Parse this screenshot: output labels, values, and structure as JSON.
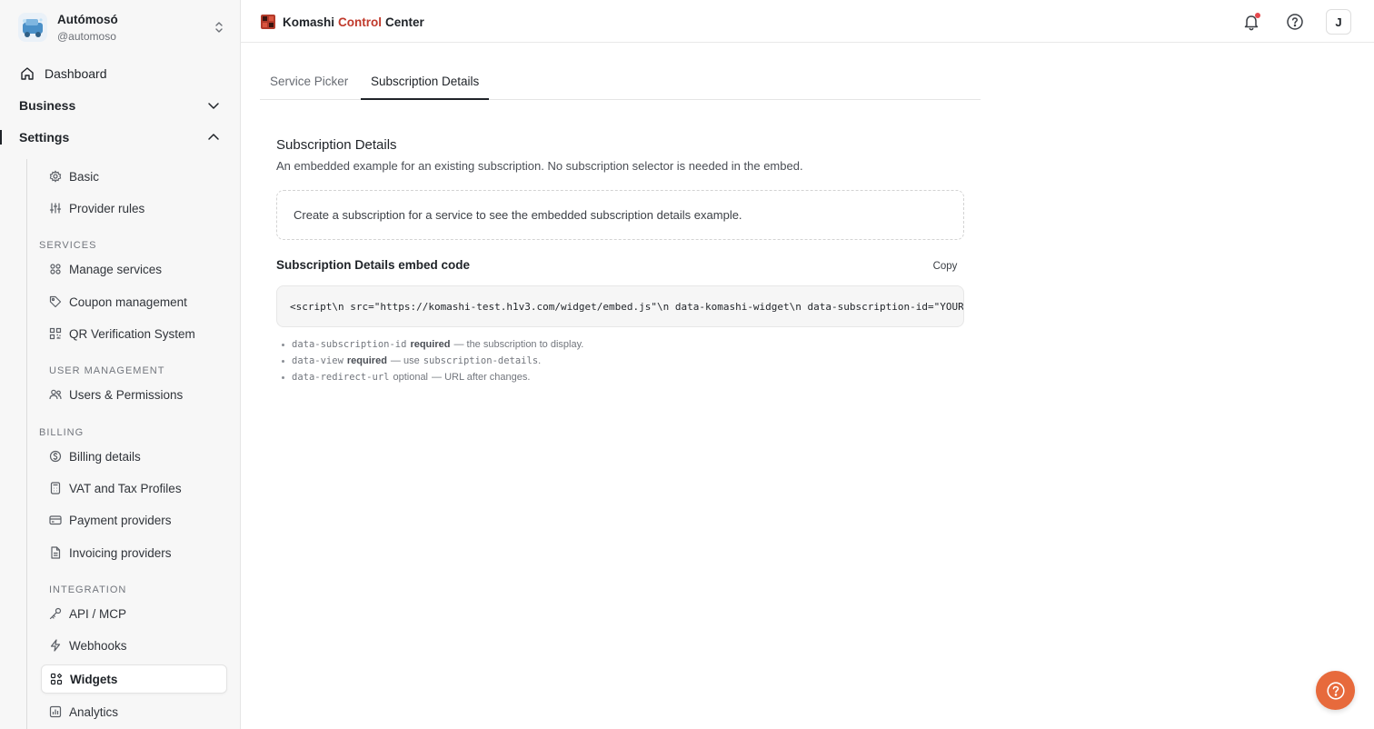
{
  "account": {
    "name": "Autómosó",
    "handle": "@automoso"
  },
  "nav": {
    "dashboard": "Dashboard",
    "business": "Business",
    "settings": "Settings",
    "basic": "Basic",
    "provider_rules": "Provider rules",
    "services_section": "SERVICES",
    "manage_services": "Manage services",
    "coupon_management": "Coupon management",
    "qr_verification": "QR Verification System",
    "user_mgmt_section": "USER MANAGEMENT",
    "users_permissions": "Users & Permissions",
    "billing_section": "BILLING",
    "billing_details": "Billing details",
    "vat_tax": "VAT and Tax Profiles",
    "payment_providers": "Payment providers",
    "invoicing_providers": "Invoicing providers",
    "integration_section": "INTEGRATION",
    "api_mcp": "API / MCP",
    "webhooks": "Webhooks",
    "widgets": "Widgets",
    "analytics": "Analytics"
  },
  "header": {
    "brand_part1": "Komashi",
    "brand_part2": "Control",
    "brand_part3": "Center",
    "user_initial": "J",
    "brand_accent_color": "#c0392b"
  },
  "tabs": {
    "service_picker": "Service Picker",
    "subscription_details": "Subscription Details"
  },
  "content": {
    "title": "Subscription Details",
    "description": "An embedded example for an existing subscription. No subscription selector is needed in the embed.",
    "empty_message": "Create a subscription for a service to see the embedded subscription details example.",
    "embed_title": "Subscription Details embed code",
    "copy_label": "Copy",
    "code": "<script\\n  src=\"https://komashi-test.h1v3.com/widget/embed.js\"\\n  data-komashi-widget\\n  data-subscription-id=\"YOUR_SUBSCRIPTION_ID\"\\n  data-view=\"subscription-details\"\\n></script>",
    "notes": [
      {
        "attr": "data-subscription-id",
        "flag": "required",
        "text": "— the subscription to display."
      },
      {
        "attr": "data-view",
        "flag": "required",
        "text_before": "— use",
        "value": "subscription-details",
        "text_after": "."
      },
      {
        "attr": "data-redirect-url",
        "flag": "optional",
        "text": "— URL after changes."
      }
    ]
  },
  "colors": {
    "fab": "#e76a3c",
    "notification_dot": "#e5484d"
  }
}
